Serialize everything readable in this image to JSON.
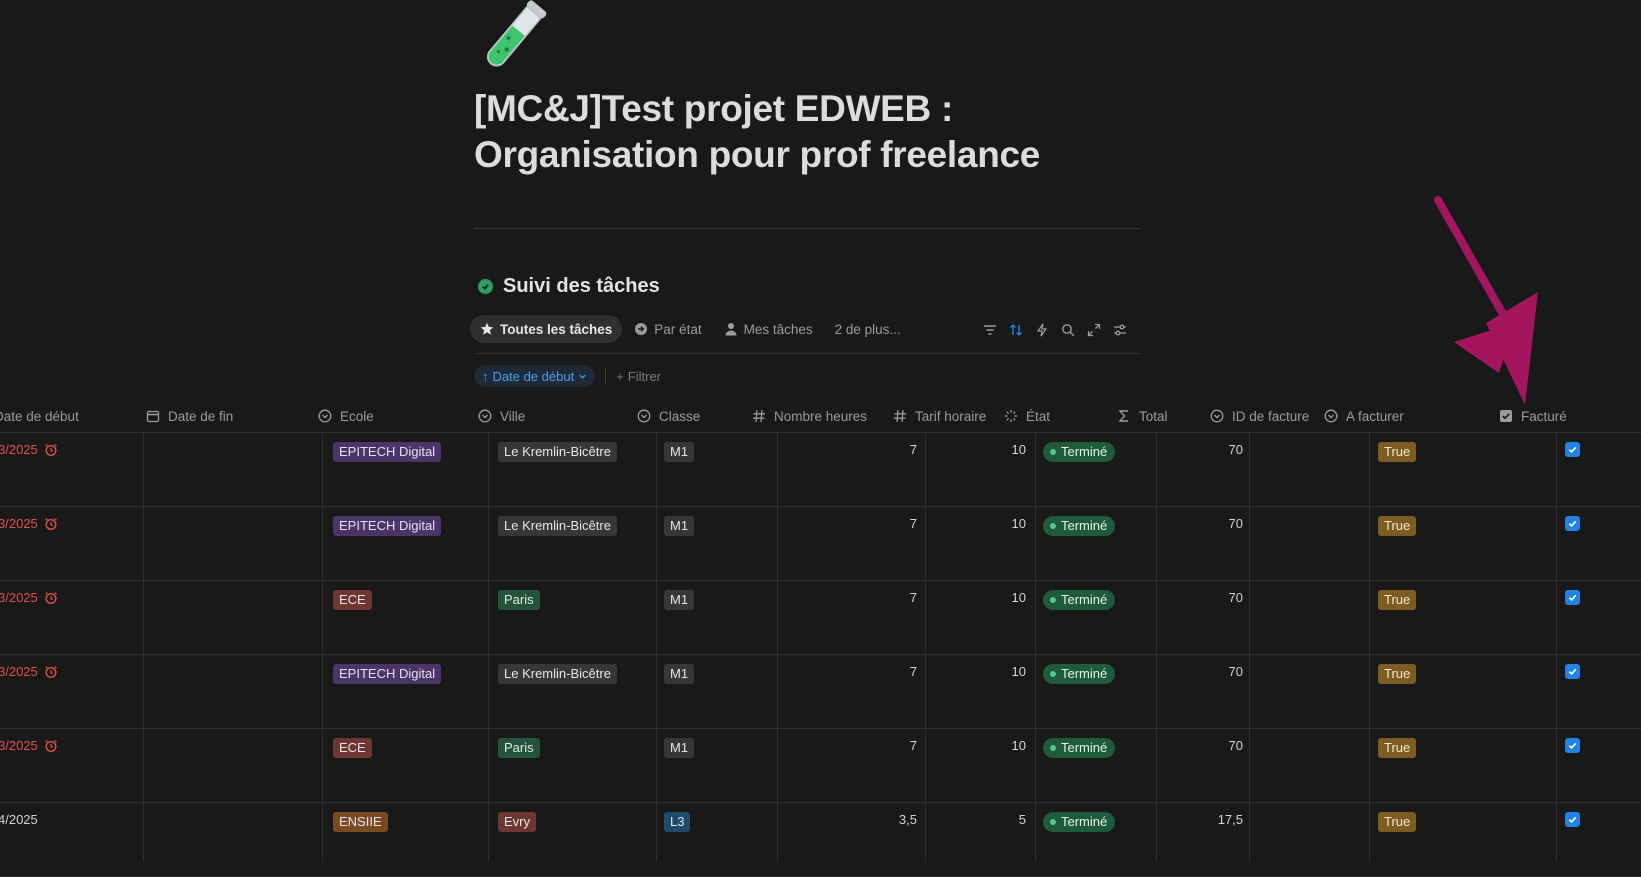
{
  "page": {
    "emoji": "test-tube-icon",
    "title_line1": "[MC&J]Test projet EDWEB :",
    "title_line2": "Organisation pour prof freelance"
  },
  "database": {
    "title": "Suivi des tâches",
    "views": [
      {
        "label": "Toutes les tâches",
        "icon": "star-icon",
        "active": true
      },
      {
        "label": "Par état",
        "icon": "circle-arrow-icon"
      },
      {
        "label": "Mes tâches",
        "icon": "person-icon"
      },
      {
        "label": "2 de plus..."
      }
    ],
    "toolbar": [
      "filter-icon",
      "sort-icon",
      "automation-icon",
      "search-icon",
      "expand-icon",
      "settings-icon"
    ],
    "sort_chip": "Date de début",
    "filter_label": "Filtrer"
  },
  "columns": [
    "Date de début",
    "Date de fin",
    "Ecole",
    "Ville",
    "Classe",
    "Nombre heures",
    "Tarif horaire",
    "État",
    "Total",
    "ID de facture",
    "A facturer",
    "Facturé"
  ],
  "rows": [
    {
      "date": "3/2025",
      "overdue": true,
      "ecole": "EPITECH Digital",
      "ecole_color": "purple",
      "ville": "Le Kremlin-Bicêtre",
      "ville_color": "gray",
      "classe": "M1",
      "classe_color": "gray",
      "heures": "7",
      "tarif": "10",
      "etat": "Terminé",
      "total": "70",
      "a_facturer": "True",
      "facture": true
    },
    {
      "date": "3/2025",
      "overdue": true,
      "ecole": "EPITECH Digital",
      "ecole_color": "purple",
      "ville": "Le Kremlin-Bicêtre",
      "ville_color": "gray",
      "classe": "M1",
      "classe_color": "gray",
      "heures": "7",
      "tarif": "10",
      "etat": "Terminé",
      "total": "70",
      "a_facturer": "True",
      "facture": true
    },
    {
      "date": "3/2025",
      "overdue": true,
      "ecole": "ECE",
      "ecole_color": "red",
      "ville": "Paris",
      "ville_color": "green",
      "classe": "M1",
      "classe_color": "gray",
      "heures": "7",
      "tarif": "10",
      "etat": "Terminé",
      "total": "70",
      "a_facturer": "True",
      "facture": true
    },
    {
      "date": "3/2025",
      "overdue": true,
      "ecole": "EPITECH Digital",
      "ecole_color": "purple",
      "ville": "Le Kremlin-Bicêtre",
      "ville_color": "gray",
      "classe": "M1",
      "classe_color": "gray",
      "heures": "7",
      "tarif": "10",
      "etat": "Terminé",
      "total": "70",
      "a_facturer": "True",
      "facture": true
    },
    {
      "date": "3/2025",
      "overdue": true,
      "ecole": "ECE",
      "ecole_color": "red",
      "ville": "Paris",
      "ville_color": "green",
      "classe": "M1",
      "classe_color": "gray",
      "heures": "7",
      "tarif": "10",
      "etat": "Terminé",
      "total": "70",
      "a_facturer": "True",
      "facture": true
    },
    {
      "date": "4/2025",
      "overdue": false,
      "ecole": "ENSIIE",
      "ecole_color": "orange",
      "ville": "Evry",
      "ville_color": "red",
      "classe": "L3",
      "classe_color": "blue",
      "heures": "3,5",
      "tarif": "5",
      "etat": "Terminé",
      "total": "17,5",
      "a_facturer": "True",
      "facture": true
    }
  ],
  "colors": {
    "accent": "#2383e2",
    "annotation_arrow": "#a3165f",
    "tag_purple": "#4b3568",
    "tag_red": "#6e3630",
    "tag_orange": "#7a4a22",
    "tag_gray": "#373737",
    "tag_green": "#24533a",
    "tag_blue": "#1f4a6a",
    "tag_yellow": "#7d5c23",
    "status_green": "#1f5a3b",
    "overdue": "#e0504b"
  }
}
